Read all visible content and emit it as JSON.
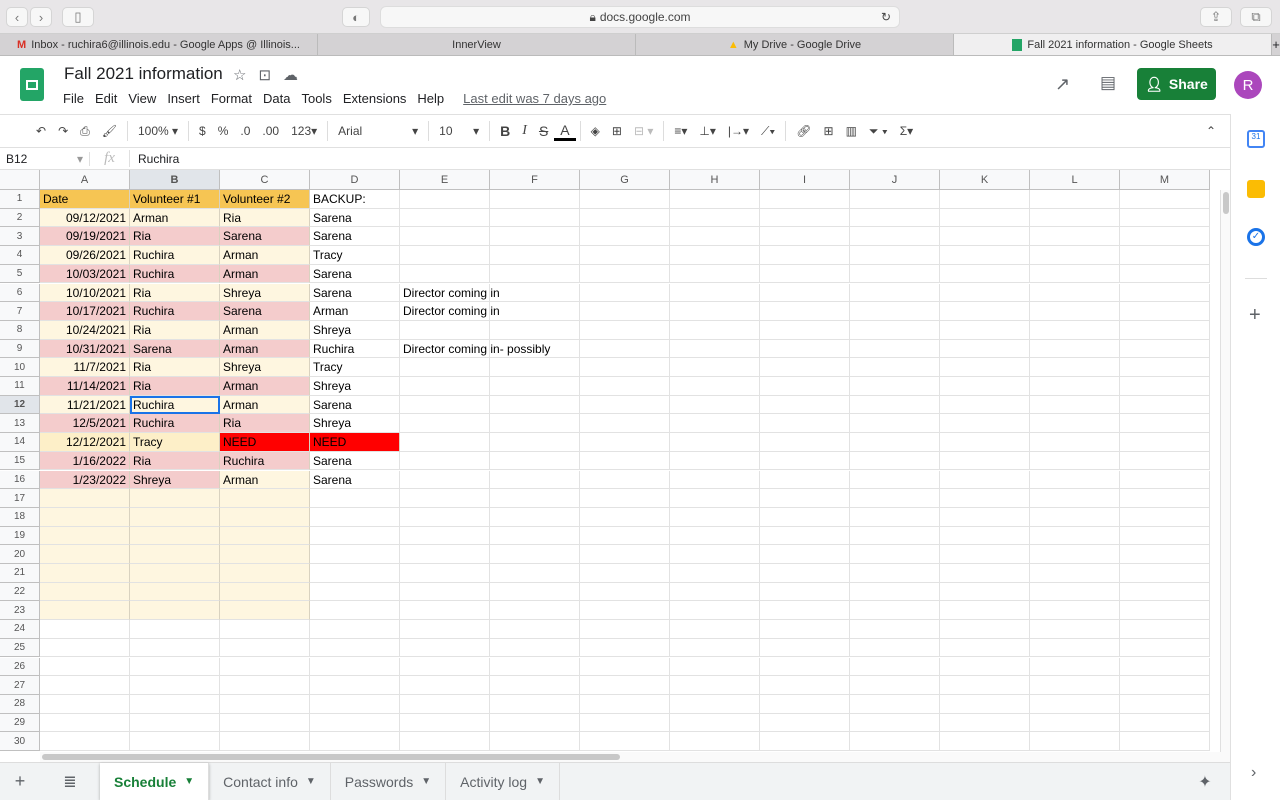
{
  "browser": {
    "url": "docs.google.com",
    "tabs": [
      {
        "label": "Inbox - ruchira6@illinois.edu - Google Apps @ Illinois...",
        "icon": "gmail"
      },
      {
        "label": "InnerView"
      },
      {
        "label": "My Drive - Google Drive",
        "icon": "drive"
      },
      {
        "label": "Fall 2021 information - Google Sheets",
        "icon": "sheets"
      }
    ]
  },
  "doc": {
    "title": "Fall 2021 information",
    "last_edit": "Last edit was 7 days ago",
    "share": "Share",
    "avatar": "R"
  },
  "menu": [
    "File",
    "Edit",
    "View",
    "Insert",
    "Format",
    "Data",
    "Tools",
    "Extensions",
    "Help"
  ],
  "toolbar": {
    "zoom": "100%",
    "currency": "$",
    "percent": "%",
    "dec_less": ".0",
    "dec_more": ".00",
    "format": "123",
    "font": "Arial",
    "size": "10",
    "bold": "B",
    "italic": "I",
    "strike": "S",
    "color": "A"
  },
  "formula": {
    "cell_ref": "B12",
    "fx": "fx",
    "value": "Ruchira"
  },
  "colors": {
    "cream": "#fef6e0",
    "pink": "#f4cccc",
    "header": "#f6c553",
    "red": "#ff0000",
    "dcream": "#fdefc8",
    "white": "#ffffff"
  },
  "columns": [
    "A",
    "B",
    "C",
    "D",
    "E",
    "F",
    "G",
    "H",
    "I",
    "J",
    "K",
    "L",
    "M"
  ],
  "rows": [
    {
      "cells": [
        "Date",
        "Volunteer #1",
        "Volunteer #2",
        "BACKUP:",
        ""
      ],
      "fill": [
        "header",
        "header",
        "header",
        "white"
      ]
    },
    {
      "cells": [
        "09/12/2021",
        "Arman",
        "Ria",
        "Sarena",
        ""
      ],
      "fill": [
        "cream",
        "cream",
        "cream"
      ]
    },
    {
      "cells": [
        "09/19/2021",
        "Ria",
        "Sarena",
        "Sarena",
        ""
      ],
      "fill": [
        "pink",
        "pink",
        "pink"
      ]
    },
    {
      "cells": [
        "09/26/2021",
        "Ruchira",
        "Arman",
        "Tracy",
        ""
      ],
      "fill": [
        "cream",
        "cream",
        "cream"
      ]
    },
    {
      "cells": [
        "10/03/2021",
        "Ruchira",
        "Arman",
        "Sarena",
        ""
      ],
      "fill": [
        "pink",
        "pink",
        "pink"
      ]
    },
    {
      "cells": [
        "10/10/2021",
        "Ria",
        "Shreya",
        "Sarena",
        "Director coming in"
      ],
      "fill": [
        "cream",
        "cream",
        "cream"
      ]
    },
    {
      "cells": [
        "10/17/2021",
        "Ruchira",
        "Sarena",
        "Arman",
        "Director coming in"
      ],
      "fill": [
        "pink",
        "pink",
        "pink"
      ]
    },
    {
      "cells": [
        "10/24/2021",
        "Ria",
        "Arman",
        "Shreya",
        ""
      ],
      "fill": [
        "cream",
        "cream",
        "cream"
      ]
    },
    {
      "cells": [
        "10/31/2021",
        "Sarena",
        "Arman",
        "Ruchira",
        "Director coming in- possibly"
      ],
      "fill": [
        "pink",
        "pink",
        "pink"
      ]
    },
    {
      "cells": [
        "11/7/2021",
        "Ria",
        "Shreya",
        "Tracy",
        ""
      ],
      "fill": [
        "cream",
        "cream",
        "cream"
      ]
    },
    {
      "cells": [
        "11/14/2021",
        "Ria",
        "Arman",
        "Shreya",
        ""
      ],
      "fill": [
        "pink",
        "pink",
        "pink"
      ]
    },
    {
      "cells": [
        "11/21/2021",
        "Ruchira",
        "Arman",
        "Sarena",
        ""
      ],
      "fill": [
        "cream",
        "cream",
        "cream"
      ]
    },
    {
      "cells": [
        "12/5/2021",
        "Ruchira",
        "Ria",
        "Shreya",
        ""
      ],
      "fill": [
        "pink",
        "pink",
        "pink"
      ]
    },
    {
      "cells": [
        "12/12/2021",
        "Tracy",
        "NEED",
        "NEED",
        ""
      ],
      "fill": [
        "dcream",
        "dcream",
        "red",
        "red"
      ]
    },
    {
      "cells": [
        "1/16/2022",
        "Ria",
        "Ruchira",
        "Sarena",
        ""
      ],
      "fill": [
        "pink",
        "pink",
        "pink"
      ]
    },
    {
      "cells": [
        "1/23/2022",
        "Shreya",
        "Arman",
        "Sarena",
        ""
      ],
      "fill": [
        "pink",
        "pink",
        "cream"
      ]
    }
  ],
  "row_count": 30,
  "sheets": [
    {
      "label": "Schedule",
      "active": true
    },
    {
      "label": "Contact info"
    },
    {
      "label": "Passwords"
    },
    {
      "label": "Activity log"
    }
  ]
}
